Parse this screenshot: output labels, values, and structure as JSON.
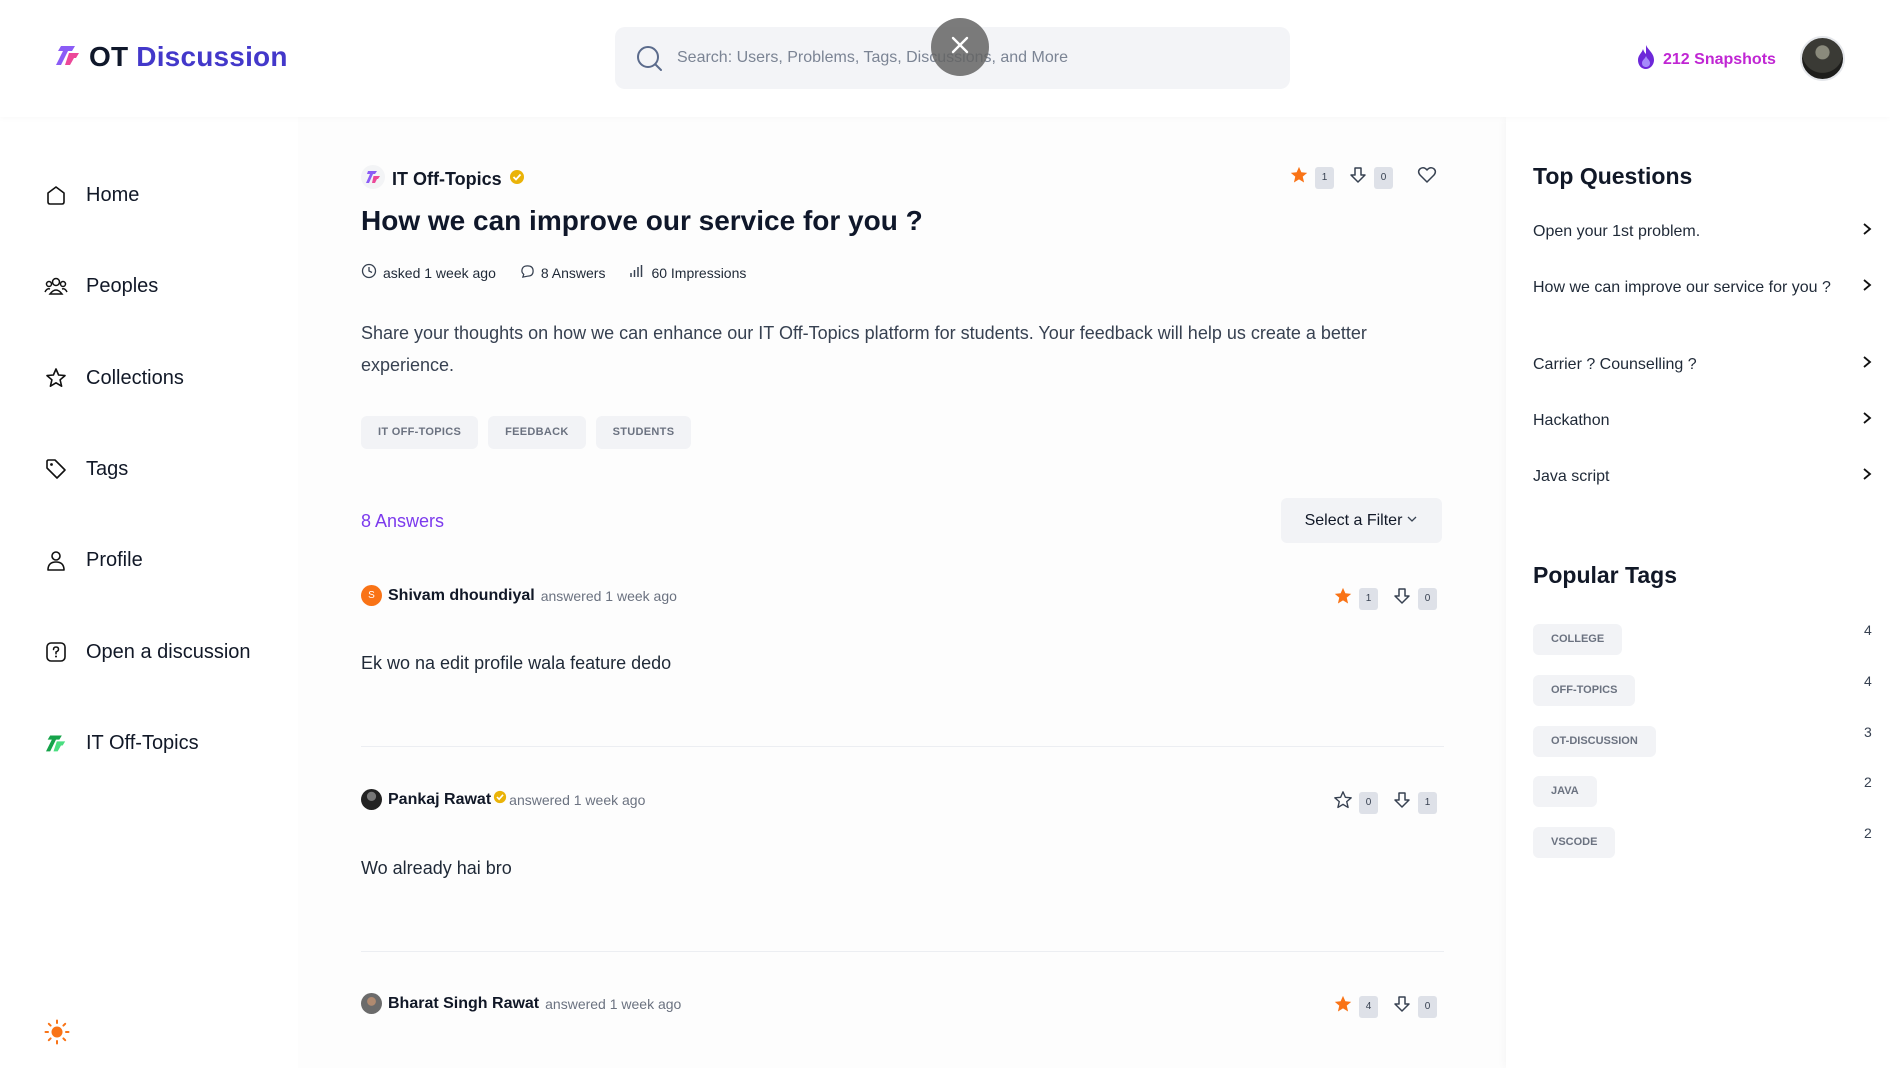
{
  "header": {
    "logo_ot": "OT",
    "logo_discussion": "Discussion",
    "search_placeholder": "Search: Users, Problems, Tags, Discussions, and More",
    "snapshots": "212 Snapshots",
    "brand_color": "#4338ca",
    "snapshot_color": "#c026d3"
  },
  "sidebar": {
    "items": [
      {
        "label": "Home",
        "icon": "home-icon"
      },
      {
        "label": "Peoples",
        "icon": "people-icon"
      },
      {
        "label": "Collections",
        "icon": "star-icon"
      },
      {
        "label": "Tags",
        "icon": "tag-icon"
      },
      {
        "label": "Profile",
        "icon": "user-icon"
      },
      {
        "label": "Open a discussion",
        "icon": "question-icon"
      },
      {
        "label": "IT Off-Topics",
        "icon": "community-logo-icon"
      }
    ]
  },
  "question": {
    "community": "IT Off-Topics",
    "title": "How we can improve our service for you ?",
    "asked": "asked 1 week ago",
    "answers_meta": "8 Answers",
    "impressions": "60 Impressions",
    "body": "Share your thoughts on how we can enhance our IT Off-Topics platform for students. Your feedback will help us create a better experience.",
    "upvotes": "1",
    "downvotes": "0",
    "tags": [
      "IT OFF-TOPICS",
      "FEEDBACK",
      "STUDENTS"
    ]
  },
  "answers_section": {
    "count_label": "8 Answers",
    "filter_label": "Select a Filter"
  },
  "answers": [
    {
      "author": "Shivam dhoundiyal",
      "when": "answered 1 week ago",
      "body": "Ek wo na edit profile wala feature dedo",
      "upvotes": "1",
      "downvotes": "0",
      "starred": true,
      "avatar_letter": "S"
    },
    {
      "author": "Pankaj Rawat",
      "when": "answered 1 week ago",
      "body": "Wo already hai bro",
      "upvotes": "0",
      "downvotes": "1",
      "starred": false,
      "avatar_letter": ""
    },
    {
      "author": "Bharat Singh Rawat",
      "when": "answered 1 week ago",
      "body": "",
      "upvotes": "4",
      "downvotes": "0",
      "starred": true,
      "avatar_letter": ""
    }
  ],
  "top_questions": {
    "title": "Top Questions",
    "items": [
      "Open your 1st problem.",
      "How we can improve our service for you ?",
      "Carrier ? Counselling ?",
      "Hackathon",
      "Java script"
    ]
  },
  "popular_tags": {
    "title": "Popular Tags",
    "items": [
      {
        "name": "COLLEGE",
        "count": "4"
      },
      {
        "name": "OFF-TOPICS",
        "count": "4"
      },
      {
        "name": "OT-DISCUSSION",
        "count": "3"
      },
      {
        "name": "JAVA",
        "count": "2"
      },
      {
        "name": "VSCODE",
        "count": "2"
      }
    ]
  }
}
